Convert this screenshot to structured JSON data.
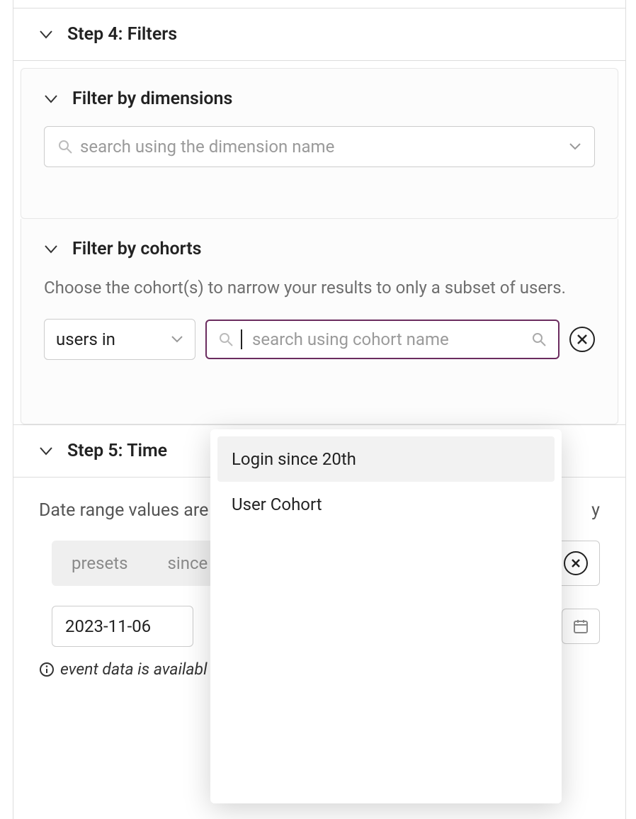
{
  "step4": {
    "title": "Step 4: Filters",
    "dimensions": {
      "title": "Filter by dimensions",
      "search_placeholder": "search using the dimension name"
    },
    "cohorts": {
      "title": "Filter by cohorts",
      "helper": "Choose the cohort(s) to narrow your results to only a subset of users.",
      "select_value": "users in",
      "search_placeholder": "search using cohort name",
      "options": [
        "Login since 20th",
        "User Cohort"
      ]
    }
  },
  "step5": {
    "title": "Step 5: Time",
    "label_left": "Date range values are a",
    "label_right": "y",
    "tabs": {
      "presets": "presets",
      "since": "since"
    },
    "date_value": "2023-11-06",
    "hint": "event data is availabl"
  }
}
